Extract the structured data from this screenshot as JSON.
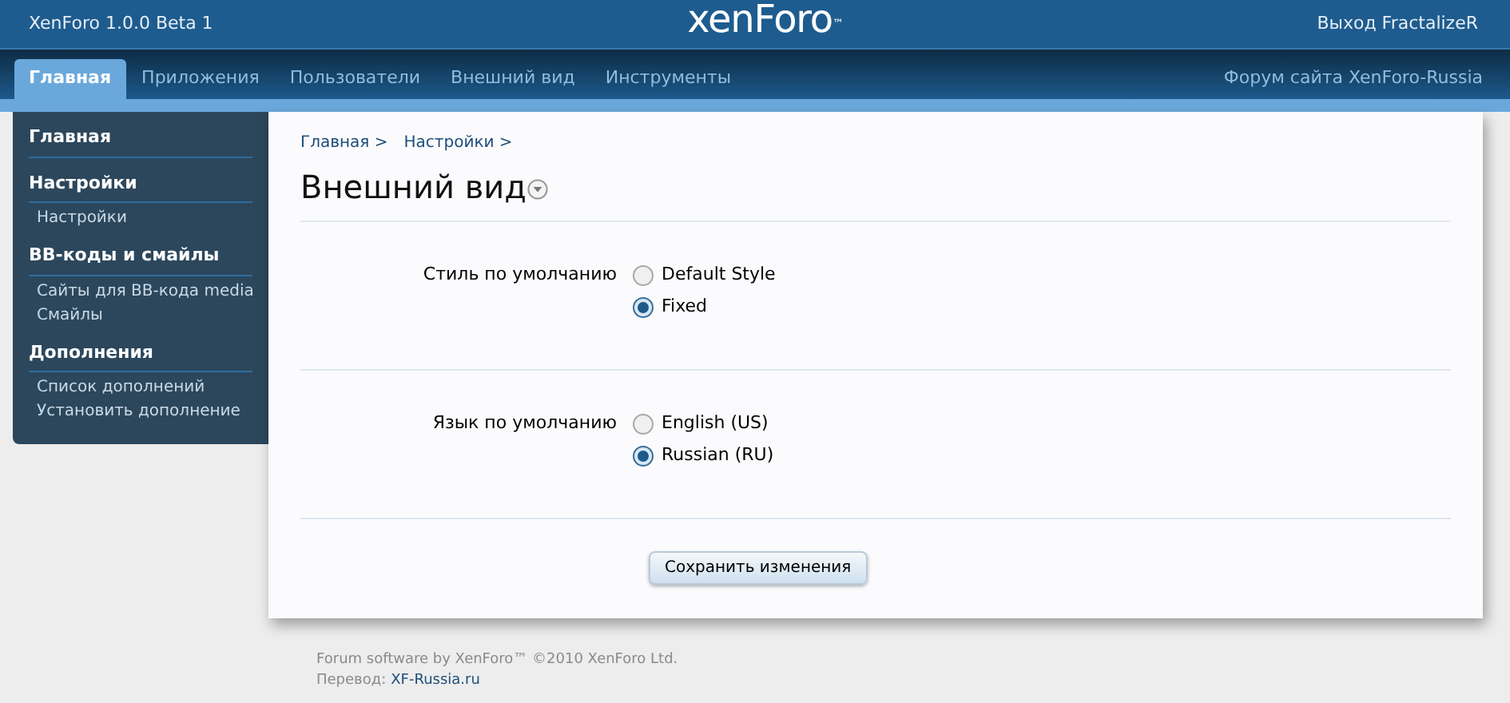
{
  "header": {
    "version": "XenForo 1.0.0 Beta 1",
    "logo": "xenForo",
    "logo_mark": "™",
    "logout": "Выход FractalizeR"
  },
  "tabs": [
    {
      "label": "Главная",
      "selected": true
    },
    {
      "label": "Приложения",
      "selected": false
    },
    {
      "label": "Пользователи",
      "selected": false
    },
    {
      "label": "Внешний вид",
      "selected": false
    },
    {
      "label": "Инструменты",
      "selected": false
    }
  ],
  "forum_link": "Форум сайта XenForo-Russia",
  "sidebar": {
    "sections": [
      {
        "title": "Главная"
      },
      {
        "title": "Настройки",
        "items": [
          "Настройки"
        ]
      },
      {
        "title": "BB-коды и смайлы",
        "items": [
          "Сайты для BB-кода media",
          "Смайлы"
        ]
      },
      {
        "title": "Дополнения",
        "items": [
          "Список дополнений",
          "Установить дополнение"
        ]
      }
    ]
  },
  "breadcrumbs": [
    "Главная >",
    "Настройки >"
  ],
  "page_title": "Внешний вид",
  "fields": [
    {
      "label": "Стиль по умолчанию",
      "options": [
        {
          "label": "Default Style",
          "selected": false
        },
        {
          "label": "Fixed",
          "selected": true
        }
      ]
    },
    {
      "label": "Язык по умолчанию",
      "options": [
        {
          "label": "English (US)",
          "selected": false
        },
        {
          "label": "Russian (RU)",
          "selected": true
        }
      ]
    }
  ],
  "save_button": "Сохранить изменения",
  "footer": {
    "copyright": "Forum software by XenForo™ ©2010 XenForo Ltd.",
    "translation_label": "Перевод:",
    "translation_link": "XF-Russia.ru"
  }
}
